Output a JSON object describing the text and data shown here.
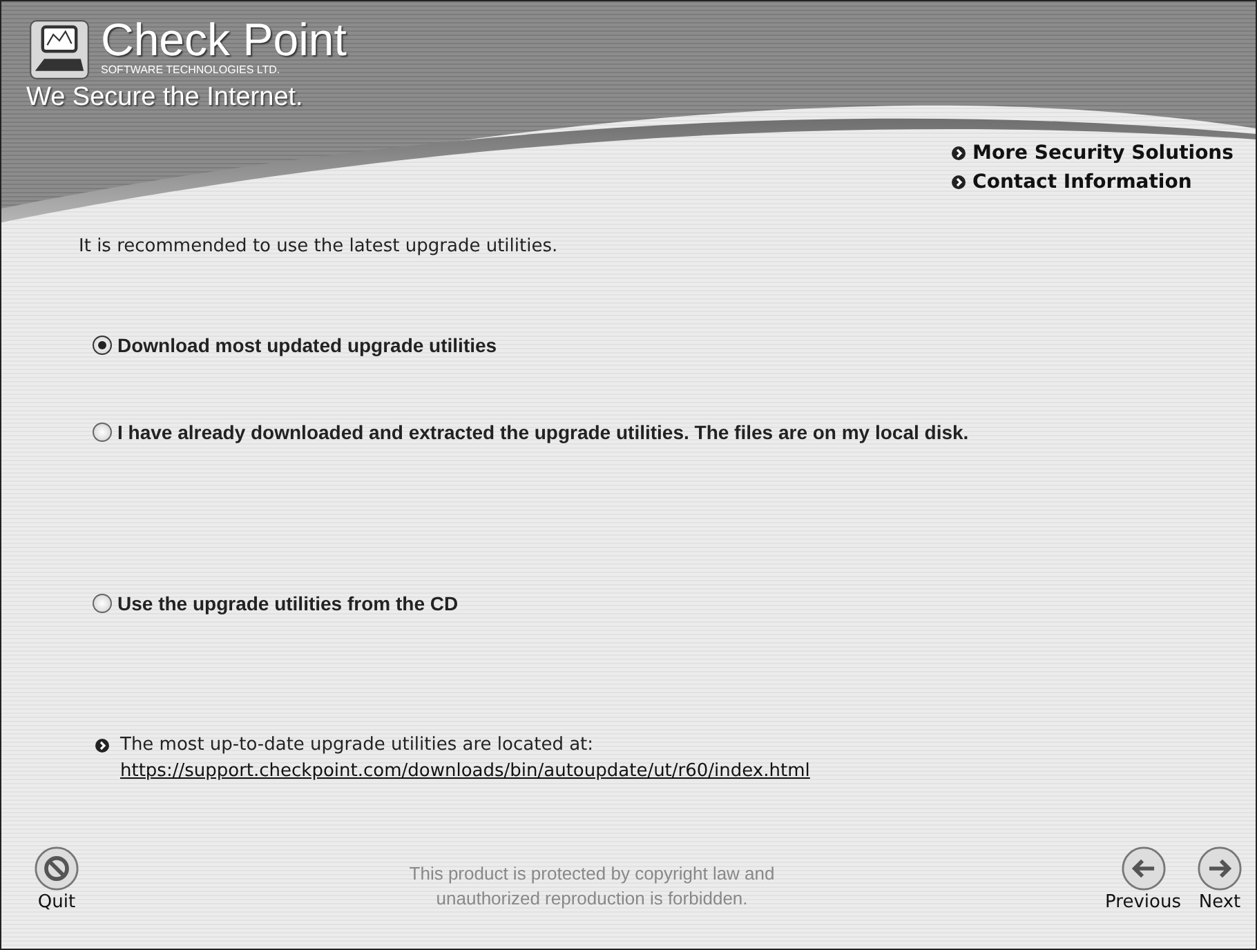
{
  "logo": {
    "name": "Check Point",
    "subtitle": "SOFTWARE TECHNOLOGIES LTD.",
    "tagline": "We Secure the Internet."
  },
  "header_links": [
    "More Security Solutions",
    "Contact Information"
  ],
  "intro": "It is recommended to use the latest upgrade utilities.",
  "options": [
    {
      "label": "Download most updated upgrade utilities",
      "selected": true
    },
    {
      "label": "I have already downloaded and extracted the upgrade utilities. The files are on my local disk.",
      "selected": false
    },
    {
      "label": "Use the upgrade utilities from the CD",
      "selected": false
    }
  ],
  "note": {
    "text": "The most up-to-date upgrade utilities are located at:",
    "link": "https://support.checkpoint.com/downloads/bin/autoupdate/ut/r60/index.html"
  },
  "footer": {
    "quit": "Quit",
    "copyright_lines": [
      "This product is protected by copyright law and",
      "unauthorized reproduction is forbidden."
    ],
    "previous": "Previous",
    "next": "Next"
  }
}
